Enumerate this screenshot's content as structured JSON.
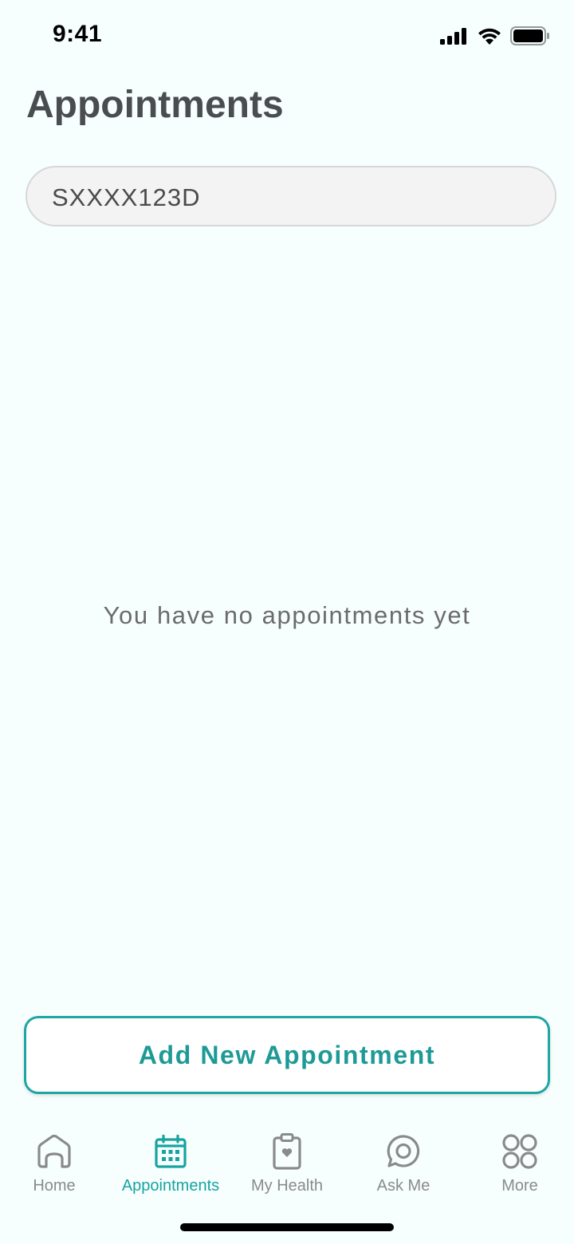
{
  "status_bar": {
    "time": "9:41"
  },
  "header": {
    "title": "Appointments"
  },
  "patient_id_field": {
    "value": "SXXXX123D"
  },
  "empty_state": {
    "message": "You have no appointments yet"
  },
  "actions": {
    "add_button_label": "Add New Appointment"
  },
  "tab_bar": {
    "items": [
      {
        "label": "Home",
        "icon": "home-icon",
        "active": false
      },
      {
        "label": "Appointments",
        "icon": "calendar-icon",
        "active": true
      },
      {
        "label": "My Health",
        "icon": "clipboard-heart-icon",
        "active": false
      },
      {
        "label": "Ask Me",
        "icon": "chat-icon",
        "active": false
      },
      {
        "label": "More",
        "icon": "grid-icon",
        "active": false
      }
    ]
  },
  "colors": {
    "accent": "#17a3a0",
    "background": "#f7fffe",
    "title_text": "#4a4d50",
    "inactive_tab": "#8a8a8a"
  }
}
